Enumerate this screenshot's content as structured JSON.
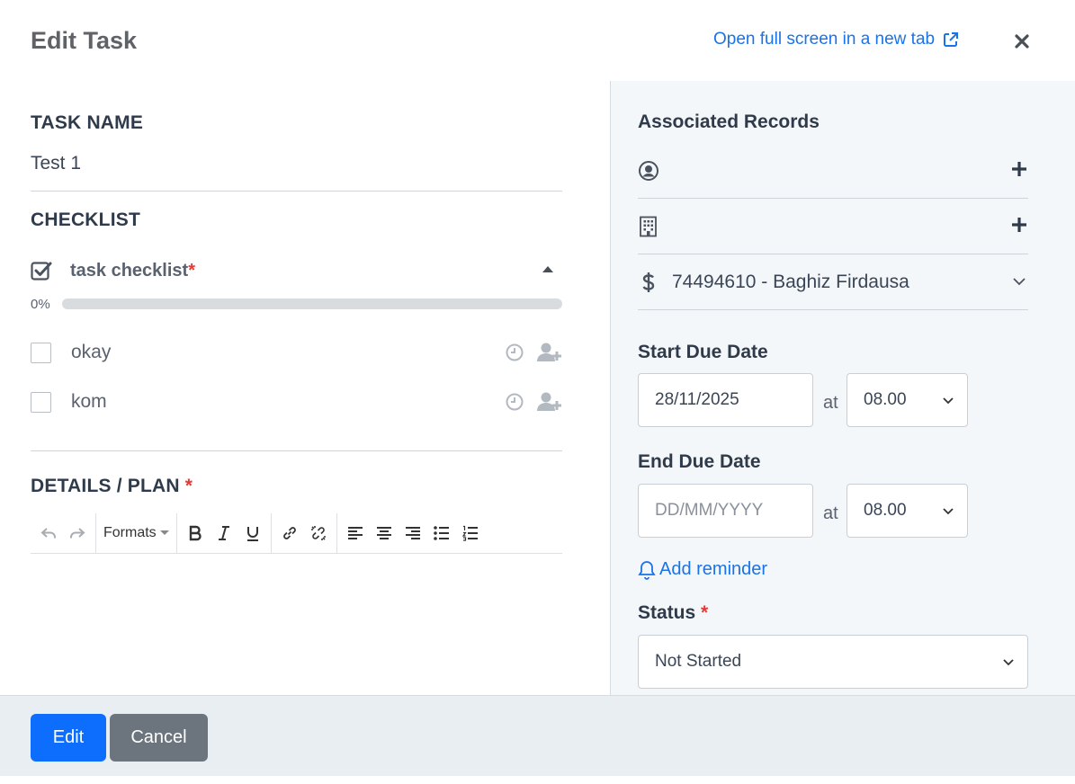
{
  "header": {
    "title": "Edit Task",
    "open_full_screen": "Open full screen in a new tab"
  },
  "task": {
    "name_label": "TASK NAME",
    "name_value": "Test 1"
  },
  "checklist": {
    "section_label": "CHECKLIST",
    "title": "task checklist",
    "required_mark": "*",
    "progress_text": "0%",
    "progress": 0,
    "items": [
      {
        "label": "okay",
        "checked": false
      },
      {
        "label": "kom",
        "checked": false
      }
    ]
  },
  "details": {
    "label": "DETAILS / PLAN",
    "required_mark": "*",
    "toolbar": {
      "formats_label": "Formats",
      "buttons": [
        "undo-icon",
        "redo-icon",
        "bold-icon",
        "italic-icon",
        "underline-icon",
        "link-icon",
        "unlink-icon",
        "align-left-icon",
        "align-center-icon",
        "align-right-icon",
        "bullet-list-icon",
        "numbered-list-icon"
      ]
    }
  },
  "associated": {
    "title": "Associated Records",
    "rows": [
      {
        "icon": "contact-icon",
        "action": "plus-icon"
      },
      {
        "icon": "company-icon",
        "action": "plus-icon"
      },
      {
        "icon": "dollar-icon",
        "text": "74494610 - Baghiz Firdausa",
        "action": "chevron-down-icon"
      }
    ]
  },
  "start_due": {
    "label": "Start Due Date",
    "date_value": "28/11/2025",
    "at_label": "at",
    "time_value": "08.00"
  },
  "end_due": {
    "label": "End Due Date",
    "date_placeholder": "DD/MM/YYYY",
    "at_label": "at",
    "time_value": "08.00"
  },
  "reminder": {
    "label": "Add reminder"
  },
  "status": {
    "label": "Status",
    "required_mark": "*",
    "value": "Not Started"
  },
  "footer": {
    "edit_label": "Edit",
    "cancel_label": "Cancel"
  },
  "colors": {
    "accent": "#1a73e8",
    "primary_button": "#0d6efd",
    "secondary_button": "#6c757d",
    "required": "#e53935"
  }
}
